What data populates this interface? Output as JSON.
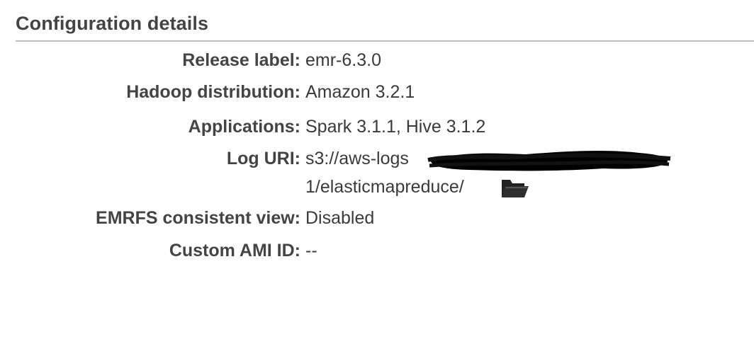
{
  "section": {
    "title": "Configuration details"
  },
  "details": [
    {
      "label": "Release label:",
      "value": "emr-6.3.0"
    },
    {
      "label": "Hadoop distribution:",
      "value": "Amazon 3.2.1"
    },
    {
      "label": "Applications:",
      "value": "Spark 3.1.1, Hive 3.1.2"
    },
    {
      "label": "Log URI:",
      "value_line1": "s3://aws-logs",
      "value_line2": "1/elasticmapreduce/",
      "icon": "folder-open-icon"
    },
    {
      "label": "EMRFS consistent view:",
      "value": "Disabled"
    },
    {
      "label": "Custom AMI ID:",
      "value": "--"
    }
  ],
  "colors": {
    "label_text": "#444444",
    "value_text": "#3a3a3a",
    "rule": "#bfbfbf",
    "redaction": "#000000"
  }
}
